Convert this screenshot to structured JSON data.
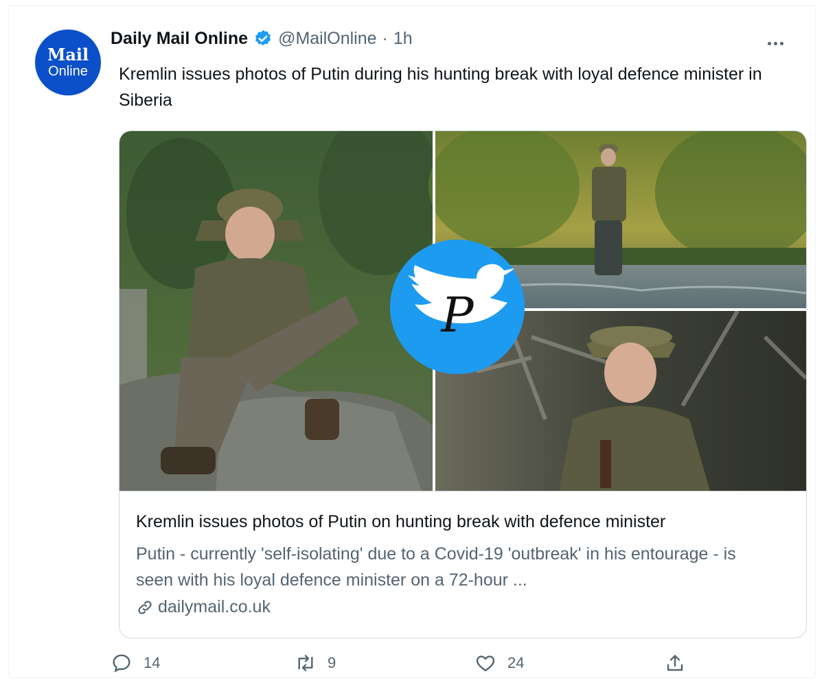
{
  "tweet": {
    "avatar": {
      "line1": "Mail",
      "line2": "Online",
      "color": "#0b4fc9"
    },
    "author_name": "Daily Mail Online",
    "verified_icon": "verified-badge-icon",
    "handle": "@MailOnline",
    "separator": "·",
    "time": "1h",
    "text": "Kremlin issues photos of Putin during his hunting break with loyal defence minister in Siberia",
    "more_icon": "more-options-icon",
    "accent_color": "#1d9bf0"
  },
  "card": {
    "title": "Kremlin issues photos of Putin on hunting break with defence minister",
    "description": "Putin - currently 'self-isolating' due to a Covid-19 'outbreak' in his entourage - is seen with his loyal defence minister on a 72-hour ...",
    "domain": "dailymail.co.uk",
    "domain_icon": "link-icon",
    "watermark_icon": "bird-logo-icon"
  },
  "actions": {
    "replies": "14",
    "retweets": "9",
    "likes": "24",
    "reply_icon": "reply-icon",
    "retweet_icon": "retweet-icon",
    "like_icon": "heart-icon",
    "share_icon": "share-icon"
  }
}
